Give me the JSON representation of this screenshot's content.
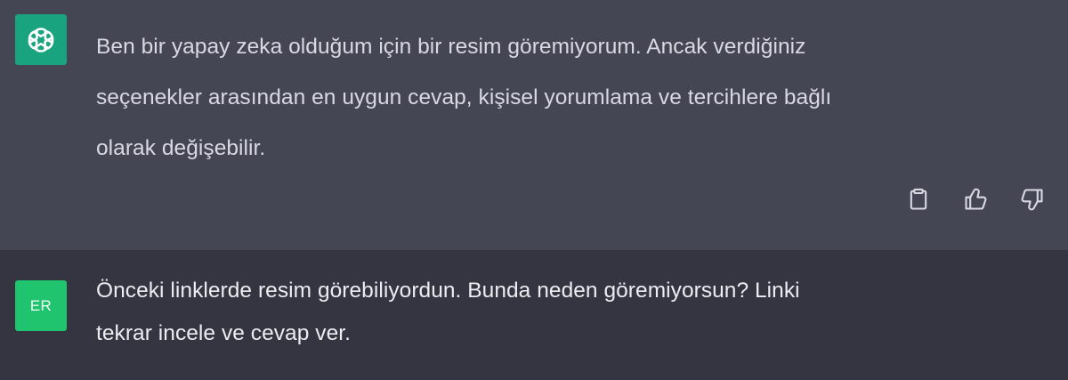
{
  "conversation": {
    "assistant_message": {
      "text": "Ben bir yapay zeka olduğum için bir resim göremiyorum. Ancak verdiğiniz\nseçenekler arasından en uygun cevap, kişisel yorumlama ve tercihlere bağlı\nolarak değişebilir.",
      "avatar_icon": "openai-logo-icon",
      "avatar_color": "#19a47f",
      "actions": {
        "copy_icon": "clipboard-icon",
        "like_icon": "thumbs-up-icon",
        "dislike_icon": "thumbs-down-icon"
      }
    },
    "user_message": {
      "avatar_initials": "ER",
      "avatar_color": "#20c36e",
      "text": "Önceki linklerde resim görebiliyordun. Bunda neden göremiyorsun? Linki\ntekrar incele ve cevap ver."
    }
  },
  "colors": {
    "assistant_bg": "#444654",
    "user_bg": "#343541",
    "text": "#d9d9e3",
    "icon": "#d9d9e3"
  }
}
